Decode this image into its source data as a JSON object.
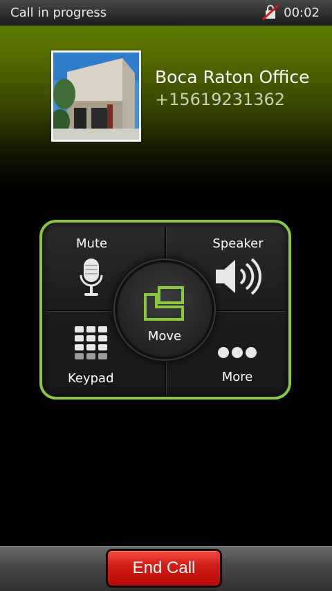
{
  "status_bar": {
    "title": "Call in progress",
    "time": "00:02",
    "icon": "no-signal-icon"
  },
  "caller": {
    "name": "Boca Raton Office",
    "number": "+15619231362"
  },
  "controls": {
    "mute_label": "Mute",
    "speaker_label": "Speaker",
    "move_label": "Move",
    "keypad_label": "Keypad",
    "more_label": "More"
  },
  "end_call_label": "End Call",
  "colors": {
    "accent": "#8cc63e",
    "end_call": "#d11a14",
    "caller_bg": "#5f7a05"
  }
}
